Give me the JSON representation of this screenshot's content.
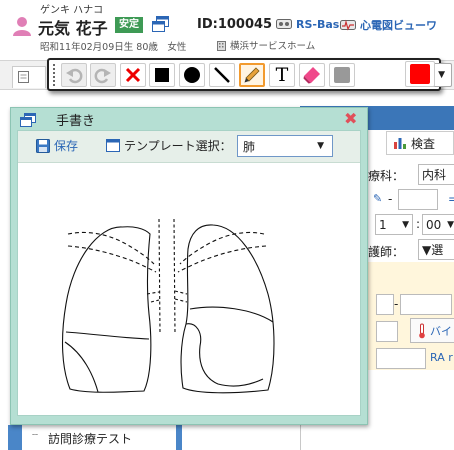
{
  "patient": {
    "kana": "ゲンキ ハナコ",
    "name": "元気 花子",
    "status_badge": "安定",
    "id": "ID:100045",
    "dob_age_sex": "昭和11年02月09日生 80歳　女性",
    "facility": "横浜サービスホーム",
    "rs_base_link": "RS-Base",
    "ecg_viewer_link": "心電図ビューワ"
  },
  "toolbar": {
    "tools": [
      "undo-icon",
      "redo-icon",
      "delete-icon",
      "square-icon",
      "circle-icon",
      "line-icon",
      "pencil-icon",
      "text-icon",
      "eraser-icon",
      "fill-gray-icon"
    ],
    "text_tool_label": "T",
    "pen_size": "2",
    "active_tool": "pencil",
    "current_color": "#ff0000"
  },
  "dialog": {
    "title": "手書き",
    "save_label": "保存",
    "template_label": "テンプレート選択：",
    "template_value": "肺"
  },
  "background": {
    "exam_tab": "検査",
    "department_label": "療科：",
    "department_value": "内科",
    "hour_value": "1",
    "minute_value": "00",
    "nurse_label": "護師：",
    "nurse_value": "▼選",
    "ra_label": "RA r",
    "nav_item": "訪問診療テスト"
  },
  "colors": {
    "dialog_bg": "#b5dfd3",
    "badge_green": "#3e9a55",
    "link_blue": "#2b66b5",
    "close_red": "#e0505a",
    "selected_color": "#ff0000"
  }
}
